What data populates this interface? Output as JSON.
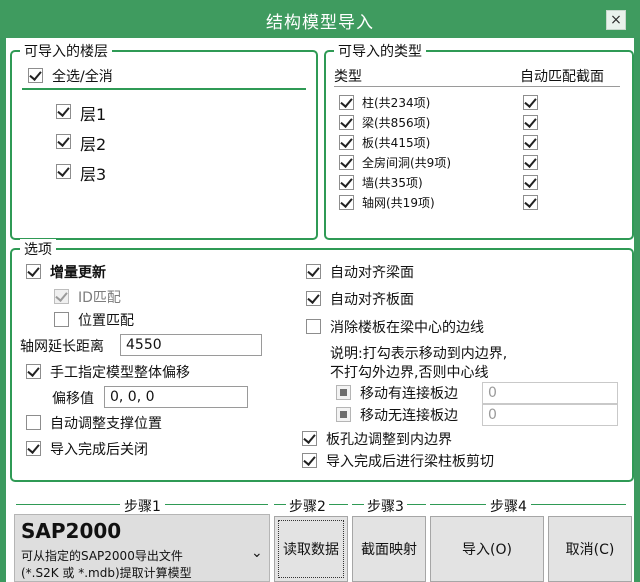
{
  "window": {
    "title": "结构模型导入",
    "close_glyph": "×"
  },
  "floors": {
    "legend": "可导入的楼层",
    "select_all_label": "全选/全消",
    "items": [
      {
        "label": "层1",
        "checked": true
      },
      {
        "label": "层2",
        "checked": true
      },
      {
        "label": "层3",
        "checked": true
      }
    ]
  },
  "types": {
    "legend": "可导入的类型",
    "col_type": "类型",
    "col_auto": "自动匹配截面",
    "items": [
      {
        "label": "柱(共234项)"
      },
      {
        "label": "梁(共856项)"
      },
      {
        "label": "板(共415项)"
      },
      {
        "label": "全房间洞(共9项)"
      },
      {
        "label": "墙(共35项)"
      },
      {
        "label": "轴网(共19项)"
      }
    ]
  },
  "options": {
    "legend": "选项",
    "incremental_update": "增量更新",
    "id_match": "ID匹配",
    "position_match": "位置匹配",
    "axis_extend_label": "轴网延长距离",
    "axis_extend_value": "4550",
    "manual_offset": "手工指定模型整体偏移",
    "offset_label": "偏移值",
    "offset_value": "0, 0, 0",
    "auto_adjust_support": "自动调整支撑位置",
    "close_after_import": "导入完成后关闭",
    "align_beam_top": "自动对齐梁面",
    "align_slab_top": "自动对齐板面",
    "eliminate_slab_edge": "消除楼板在梁中心的边线",
    "note_line1": "说明:打勾表示移动到内边界,",
    "note_line2": "不打勾外边界,否则中心线",
    "move_connected_slab": "移动有连接板边",
    "move_connected_value": "0",
    "move_unconnected_slab": "移动无连接板边",
    "move_unconnected_value": "0",
    "adjust_hole_edge": "板孔边调整到内边界",
    "cut_after_import": "导入完成后进行梁柱板剪切"
  },
  "footer": {
    "step1": "步骤1",
    "step2": "步骤2",
    "step3": "步骤3",
    "step4": "步骤4",
    "source_title": "SAP2000",
    "source_desc1": "可从指定的SAP2000导出文件",
    "source_desc2": "(*.S2K 或 *.mdb)提取计算模型",
    "dropdown_glyph": "⌄",
    "read_data": "读取数据",
    "section_map": "截面映射",
    "import": "导入(O)",
    "cancel": "取消(C)"
  }
}
